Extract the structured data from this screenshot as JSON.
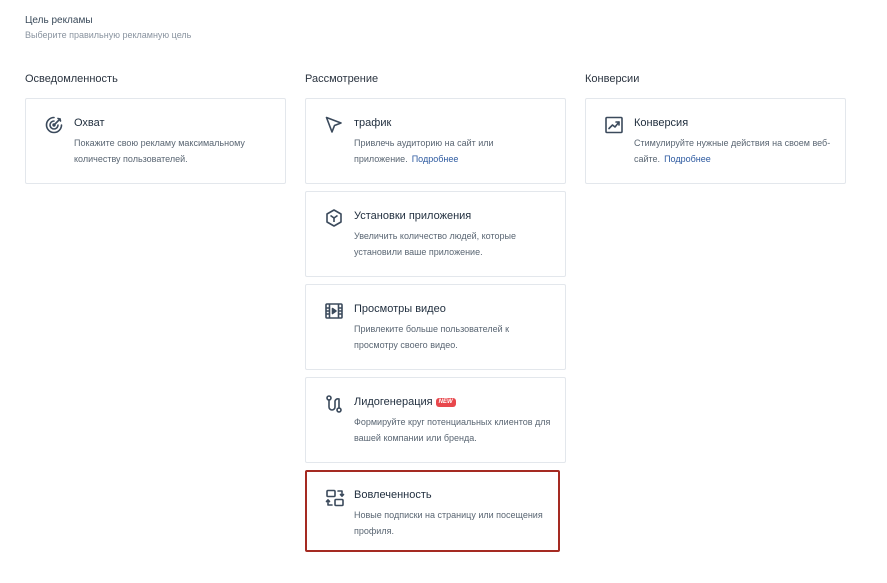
{
  "header": {
    "title": "Цель рекламы",
    "subtitle": "Выберите правильную рекламную цель"
  },
  "columns": [
    {
      "title": "Осведомленность",
      "cards": [
        {
          "icon": "target-icon",
          "title": "Охват",
          "description": "Покажите свою рекламу максимальному количеству пользователей."
        }
      ]
    },
    {
      "title": "Рассмотрение",
      "cards": [
        {
          "icon": "cursor-arrow-icon",
          "title": "трафик",
          "description": "Привлечь аудиторию на сайт или приложение.",
          "link": "Подробнее"
        },
        {
          "icon": "app-cube-icon",
          "title": "Установки приложения",
          "description": "Увеличить количество людей, которые установили ваше приложение."
        },
        {
          "icon": "video-film-icon",
          "title": "Просмотры видео",
          "description": "Привлеките больше пользователей к просмотру своего видео."
        },
        {
          "icon": "lead-generation-icon",
          "title": "Лидогенерация",
          "badge": "NEW",
          "description": "Формируйте круг потенциальных клиентов для вашей компании или бренда."
        },
        {
          "icon": "engagement-swap-icon",
          "title": "Вовлеченность",
          "description": "Новые подписки на страницу или посещения профиля.",
          "selected": true
        }
      ]
    },
    {
      "title": "Конверсии",
      "cards": [
        {
          "icon": "conversion-chart-icon",
          "title": "Конверсия",
          "description": "Стимулируйте нужные действия на своем веб-сайте.",
          "link": "Подробнее"
        }
      ]
    }
  ],
  "colors": {
    "icon": "#3b4a5c",
    "selected_border": "#a52a22",
    "link": "#2d5aa0",
    "badge": "#e8474c"
  }
}
